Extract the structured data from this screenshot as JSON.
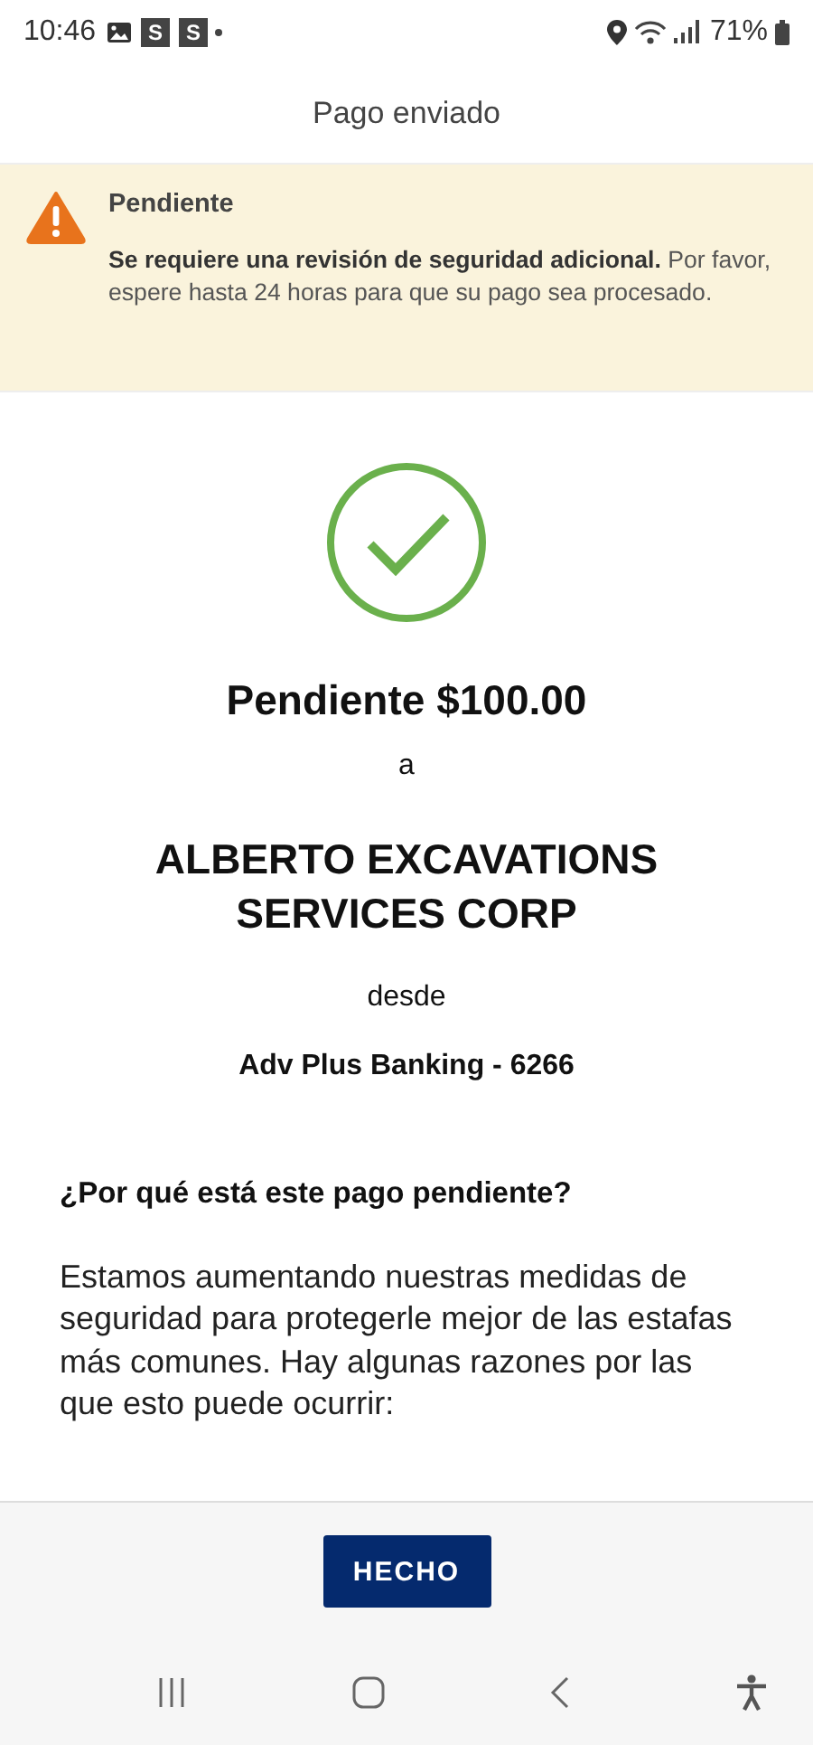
{
  "status_bar": {
    "time": "10:46",
    "badges": [
      "S",
      "S"
    ],
    "battery": "71%"
  },
  "header": {
    "title": "Pago enviado"
  },
  "alert": {
    "title": "Pendiente",
    "message": "**Se requiere una revisión de seguridad adicional.** Por favor, espere hasta 24 horas para que su pago sea procesado."
  },
  "payment": {
    "amount_line": "Pendiente $100.00",
    "to_label": "a",
    "recipient": "ALBERTO EXCAVATIONS SERVICES CORP",
    "from_label": "desde",
    "account": "Adv Plus Banking - 6266"
  },
  "info": {
    "heading": "¿Por qué está este pago pendiente?",
    "body": "Estamos aumentando nuestras medidas de seguridad para protegerle mejor de las estafas más comunes. Hay algunas razones por las que esto puede ocurrir:"
  },
  "footer": {
    "button": "HECHO"
  }
}
